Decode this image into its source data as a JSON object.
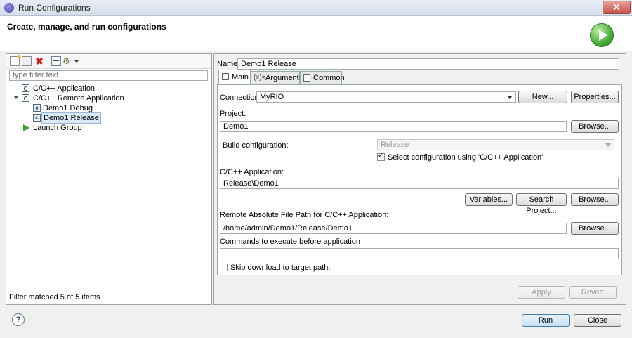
{
  "window": {
    "title": "Run Configurations",
    "close_label": "✕"
  },
  "header": {
    "text": "Create, manage, and run configurations"
  },
  "left": {
    "filter_placeholder": "type filter text",
    "tree": [
      {
        "label": "C/C++ Application"
      },
      {
        "label": "C/C++ Remote Application"
      },
      {
        "label": "Demo1 Debug"
      },
      {
        "label": "Demo1 Release",
        "selected": true
      },
      {
        "label": "Launch Group"
      }
    ],
    "status": "Filter matched 5 of 5 items",
    "toolbar_icons": [
      "new-config-icon",
      "duplicate-icon",
      "delete-icon",
      "collapse-all-icon",
      "filter-icon",
      "view-menu-icon"
    ]
  },
  "right": {
    "name_label": "Name:",
    "name_value": "Demo1 Release",
    "tabs": [
      {
        "label": "Main"
      },
      {
        "label": "Arguments"
      },
      {
        "label": "Common"
      }
    ],
    "connection_label": "Connection:",
    "connection_value": "MyRIO",
    "new_button": "New...",
    "properties_button": "Properties...",
    "project_label": "Project:",
    "project_value": "Demo1",
    "browse_label": "Browse...",
    "build_config_label": "Build configuration:",
    "build_config_value": "Release",
    "select_config_label": "Select configuration using 'C/C++ Application'",
    "cpp_app_label": "C/C++ Application:",
    "cpp_app_value": "Release\\Demo1",
    "variables_button": "Variables...",
    "search_project_button": "Search Project...",
    "remote_path_label": "Remote Absolute File Path for C/C++ Application:",
    "remote_path_value": "/home/admin/Demo1/Release/Demo1",
    "commands_label": "Commands to execute before application",
    "commands_value": "",
    "skip_download_label": "Skip download to target path.",
    "apply_button": "Apply",
    "revert_button": "Revert"
  },
  "footer": {
    "help": "?",
    "run_button": "Run",
    "close_button": "Close"
  }
}
